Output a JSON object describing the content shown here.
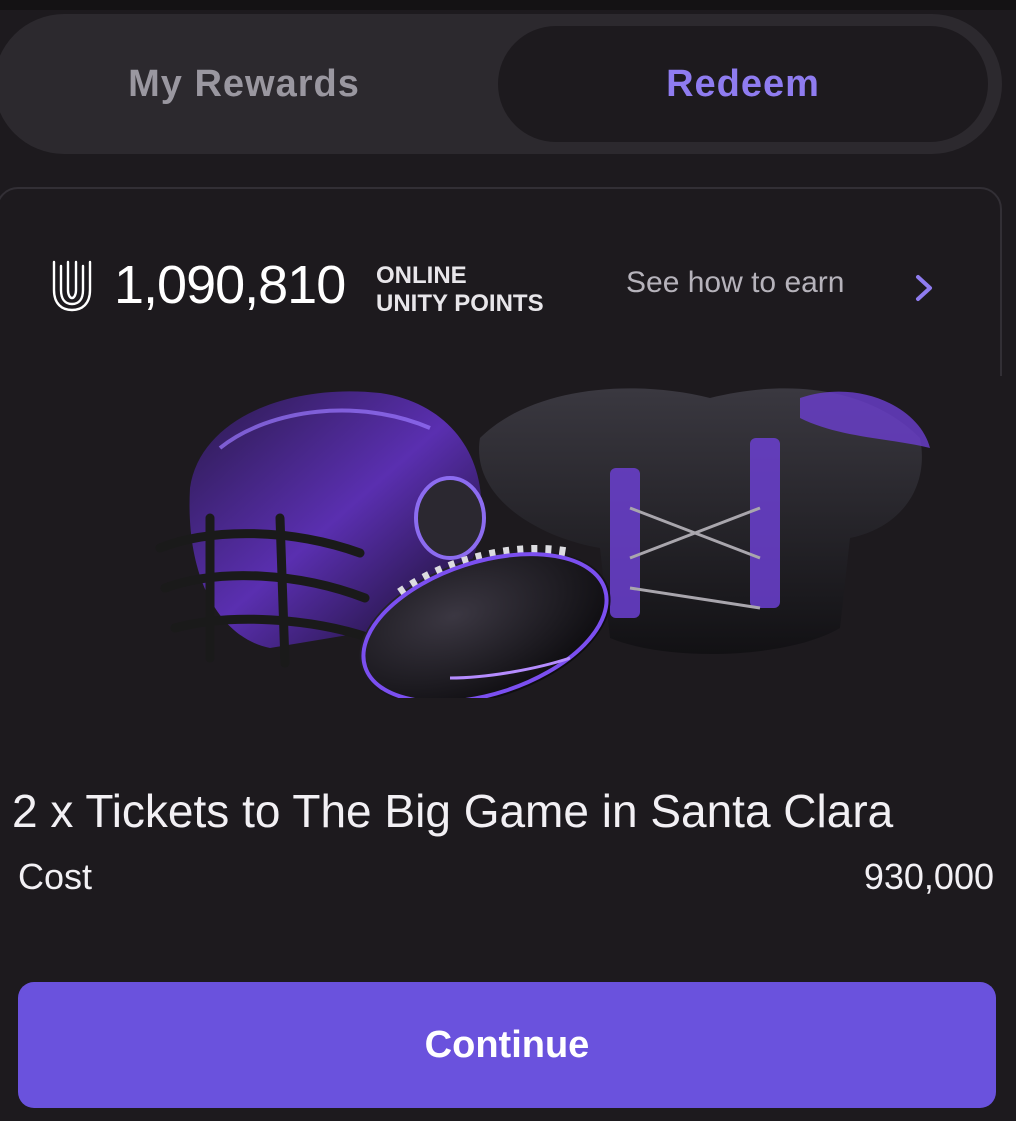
{
  "tabs": [
    {
      "label": "My Rewards",
      "active": false
    },
    {
      "label": "Redeem",
      "active": true
    }
  ],
  "points": {
    "value": "1,090,810",
    "label_line1": "ONLINE",
    "label_line2": "UNITY POINTS",
    "earn_link": "See how to earn"
  },
  "reward": {
    "title": "2 x Tickets to The Big Game in Santa Clara",
    "cost_label": "Cost",
    "cost_value": "930,000"
  },
  "continue_label": "Continue",
  "icons": {
    "brand": "unity-logo-icon",
    "chevron": "chevron-right-icon"
  },
  "colors": {
    "background": "#1d1a1e",
    "accent": "#6a52dd",
    "tab_active_text": "#8f7cf0",
    "tab_inactive_text": "#9a97a0"
  }
}
